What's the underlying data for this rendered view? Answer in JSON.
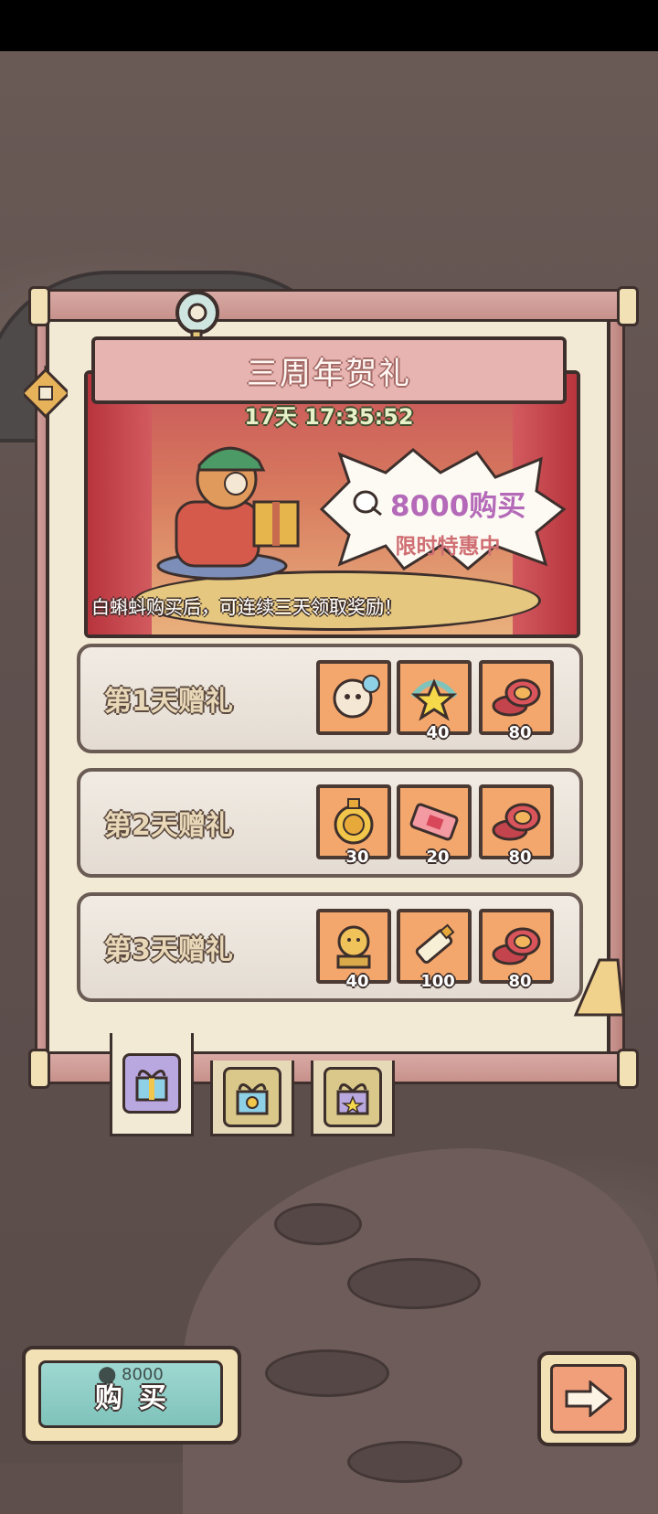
{
  "title": "三周年贺礼",
  "timer": "17天 17:35:52",
  "banner": {
    "price": "8000购买",
    "subtitle": "限时特惠中",
    "caption": "白蝌蚪购买后，可连续三天领取奖励！"
  },
  "rows": [
    {
      "label": "第1天赠礼",
      "items": [
        {
          "icon": "costume-icon",
          "count": ""
        },
        {
          "icon": "star-icon",
          "count": "40"
        },
        {
          "icon": "coins-icon",
          "count": "80"
        }
      ]
    },
    {
      "label": "第2天赠礼",
      "items": [
        {
          "icon": "medal-icon",
          "count": "30"
        },
        {
          "icon": "ticket-icon",
          "count": "20"
        },
        {
          "icon": "coins-icon",
          "count": "80"
        }
      ]
    },
    {
      "label": "第3天赠礼",
      "items": [
        {
          "icon": "statue-icon",
          "count": "40"
        },
        {
          "icon": "tube-icon",
          "count": "100"
        },
        {
          "icon": "coins-icon",
          "count": "80"
        }
      ]
    }
  ],
  "tabs": [
    {
      "name": "gift-tab-1",
      "icon": "gift-box-icon",
      "active": true
    },
    {
      "name": "gift-tab-2",
      "icon": "gift-box-icon",
      "active": false
    },
    {
      "name": "gift-tab-3",
      "icon": "gift-box-icon",
      "active": false
    }
  ],
  "buy_button": {
    "cost": "8000",
    "label": "购买"
  },
  "colors": {
    "accent": "#b46ab8",
    "button_teal": "#7fc3bb",
    "item_bg": "#f4a76c"
  }
}
